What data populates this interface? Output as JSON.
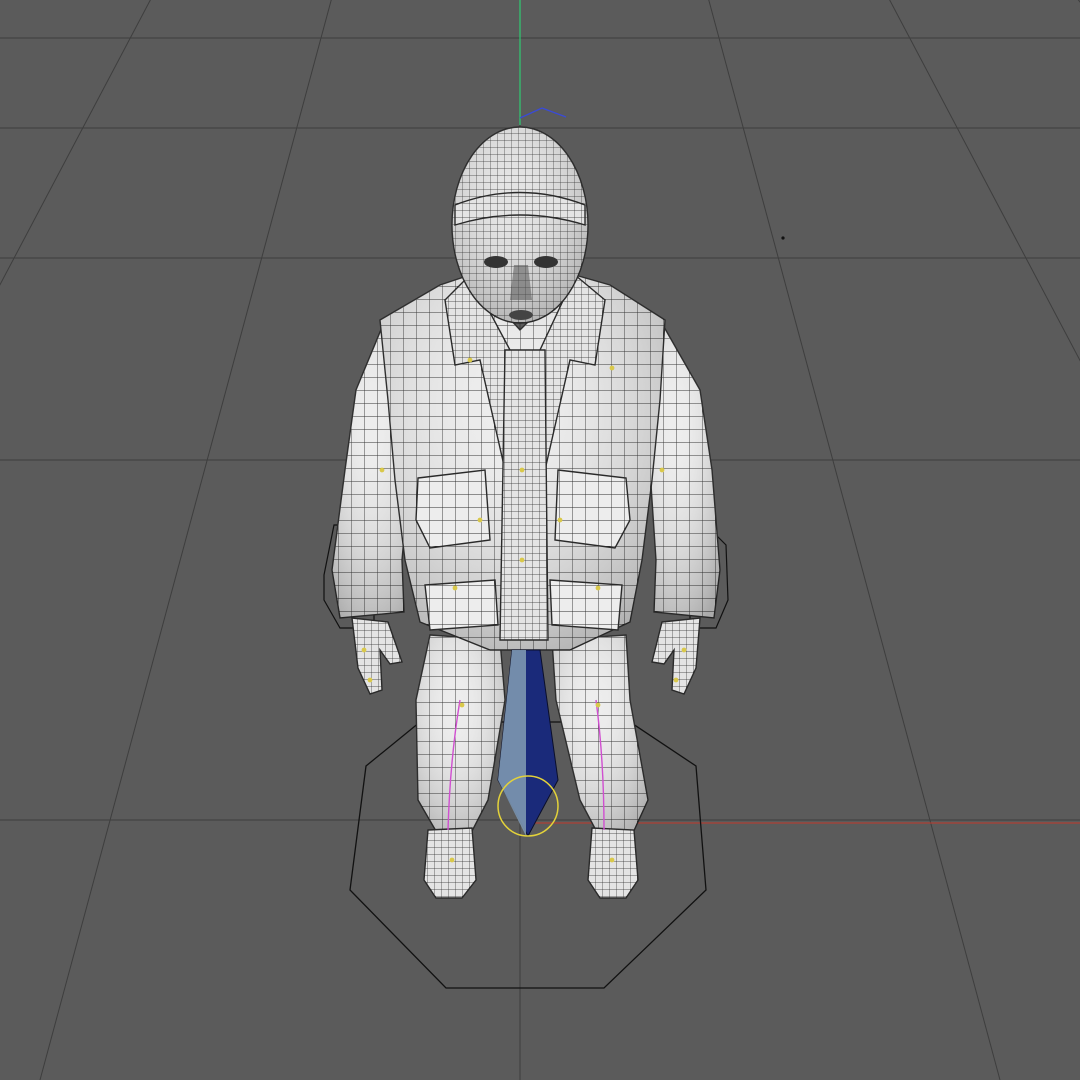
{
  "viewport": {
    "view": "perspective",
    "background_color": "#5b5b5b",
    "grid_color": "#3e3e3e",
    "grid_visible": true
  },
  "axes": {
    "x_axis_color": "#c0392b",
    "y_axis_color": "#2ecc71",
    "z_axis_color": "#3a4bd6"
  },
  "model": {
    "type": "character-mesh",
    "display_mode": "shaded-wireframe",
    "surface_color": "#eeeeee",
    "wire_color": "#2a2a2a"
  },
  "rig": {
    "ground_control_shape": "octagon",
    "control_color": "#111111",
    "pivot_bone_color": "#1a2a7a",
    "pivot_circle_color": "#e3d23a",
    "joint_marker_color": "#d9c84a",
    "spine_curve_color": "#d04fd0"
  }
}
